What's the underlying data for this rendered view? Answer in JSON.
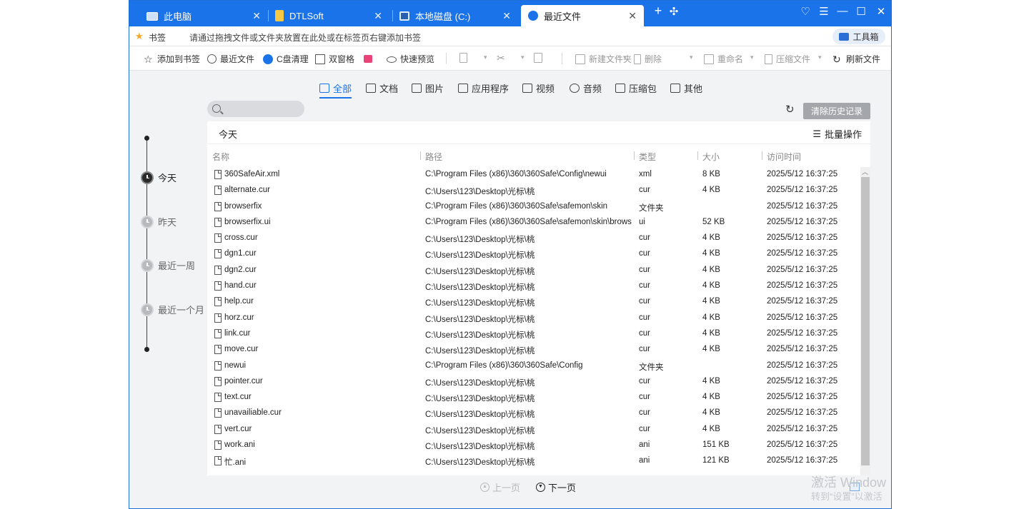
{
  "colors": {
    "accent": "#1a73e8",
    "titlebar": "#1a73e8",
    "clear_button": "#a3a6ab"
  },
  "tabs": [
    {
      "label": "此电脑",
      "icon": "computer-icon"
    },
    {
      "label": "DTLSoft",
      "icon": "folder-icon"
    },
    {
      "label": "本地磁盘 (C:)",
      "icon": "disk-icon"
    },
    {
      "label": "最近文件",
      "icon": "recent-files-icon",
      "active": true
    }
  ],
  "bookmarks": {
    "label": "书签",
    "hint": "请通过拖拽文件或文件夹放置在此处或在标签页右键添加书签",
    "toolbox": "工具箱"
  },
  "toolbar": {
    "add_bookmark": "添加到书签",
    "recent_files": "最近文件",
    "c_cleanup": "C盘清理",
    "dual_pane": "双窗格",
    "quick_preview": "快速预览",
    "new_folder": "新建文件夹",
    "delete": "删除",
    "rename": "重命名",
    "compress": "压缩文件",
    "refresh_files": "刷新文件"
  },
  "categories": [
    {
      "label": "全部",
      "active": true
    },
    {
      "label": "文档"
    },
    {
      "label": "图片"
    },
    {
      "label": "应用程序"
    },
    {
      "label": "视频"
    },
    {
      "label": "音频"
    },
    {
      "label": "压缩包"
    },
    {
      "label": "其他"
    }
  ],
  "clear_history": "清除历史记录",
  "timeline": [
    {
      "label": "今天",
      "active": true
    },
    {
      "label": "昨天"
    },
    {
      "label": "最近一周"
    },
    {
      "label": "最近一个月"
    }
  ],
  "panel": {
    "day_label": "今天",
    "batch": "批量操作",
    "columns": {
      "name": "名称",
      "path": "路径",
      "type": "类型",
      "size": "大小",
      "time": "访问时间"
    }
  },
  "files": [
    {
      "name": "360SafeAir.xml",
      "path": "C:\\Program Files (x86)\\360\\360Safe\\Config\\newui",
      "type": "xml",
      "size": "8 KB",
      "time": "2025/5/12 16:37:25"
    },
    {
      "name": "alternate.cur",
      "path": "C:\\Users\\123\\Desktop\\光标\\桃",
      "type": "cur",
      "size": "4 KB",
      "time": "2025/5/12 16:37:25"
    },
    {
      "name": "browserfix",
      "path": "C:\\Program Files (x86)\\360\\360Safe\\safemon\\skin",
      "type": "文件夹",
      "size": "",
      "time": "2025/5/12 16:37:25"
    },
    {
      "name": "browserfix.ui",
      "path": "C:\\Program Files (x86)\\360\\360Safe\\safemon\\skin\\brows",
      "type": "ui",
      "size": "52 KB",
      "time": "2025/5/12 16:37:25"
    },
    {
      "name": "cross.cur",
      "path": "C:\\Users\\123\\Desktop\\光标\\桃",
      "type": "cur",
      "size": "4 KB",
      "time": "2025/5/12 16:37:25"
    },
    {
      "name": "dgn1.cur",
      "path": "C:\\Users\\123\\Desktop\\光标\\桃",
      "type": "cur",
      "size": "4 KB",
      "time": "2025/5/12 16:37:25"
    },
    {
      "name": "dgn2.cur",
      "path": "C:\\Users\\123\\Desktop\\光标\\桃",
      "type": "cur",
      "size": "4 KB",
      "time": "2025/5/12 16:37:25"
    },
    {
      "name": "hand.cur",
      "path": "C:\\Users\\123\\Desktop\\光标\\桃",
      "type": "cur",
      "size": "4 KB",
      "time": "2025/5/12 16:37:25"
    },
    {
      "name": "help.cur",
      "path": "C:\\Users\\123\\Desktop\\光标\\桃",
      "type": "cur",
      "size": "4 KB",
      "time": "2025/5/12 16:37:25"
    },
    {
      "name": "horz.cur",
      "path": "C:\\Users\\123\\Desktop\\光标\\桃",
      "type": "cur",
      "size": "4 KB",
      "time": "2025/5/12 16:37:25"
    },
    {
      "name": "link.cur",
      "path": "C:\\Users\\123\\Desktop\\光标\\桃",
      "type": "cur",
      "size": "4 KB",
      "time": "2025/5/12 16:37:25"
    },
    {
      "name": "move.cur",
      "path": "C:\\Users\\123\\Desktop\\光标\\桃",
      "type": "cur",
      "size": "4 KB",
      "time": "2025/5/12 16:37:25"
    },
    {
      "name": "newui",
      "path": "C:\\Program Files (x86)\\360\\360Safe\\Config",
      "type": "文件夹",
      "size": "",
      "time": "2025/5/12 16:37:25"
    },
    {
      "name": "pointer.cur",
      "path": "C:\\Users\\123\\Desktop\\光标\\桃",
      "type": "cur",
      "size": "4 KB",
      "time": "2025/5/12 16:37:25"
    },
    {
      "name": "text.cur",
      "path": "C:\\Users\\123\\Desktop\\光标\\桃",
      "type": "cur",
      "size": "4 KB",
      "time": "2025/5/12 16:37:25"
    },
    {
      "name": "unavailiable.cur",
      "path": "C:\\Users\\123\\Desktop\\光标\\桃",
      "type": "cur",
      "size": "4 KB",
      "time": "2025/5/12 16:37:25"
    },
    {
      "name": "vert.cur",
      "path": "C:\\Users\\123\\Desktop\\光标\\桃",
      "type": "cur",
      "size": "4 KB",
      "time": "2025/5/12 16:37:25"
    },
    {
      "name": "work.ani",
      "path": "C:\\Users\\123\\Desktop\\光标\\桃",
      "type": "ani",
      "size": "151 KB",
      "time": "2025/5/12 16:37:25"
    },
    {
      "name": "忙.ani",
      "path": "C:\\Users\\123\\Desktop\\光标\\桃",
      "type": "ani",
      "size": "121 KB",
      "time": "2025/5/12 16:37:25"
    }
  ],
  "pager": {
    "prev": "上一页",
    "next": "下一页"
  },
  "watermark": {
    "line1": "激活 Window",
    "line2": "转到“设置”以激活"
  }
}
